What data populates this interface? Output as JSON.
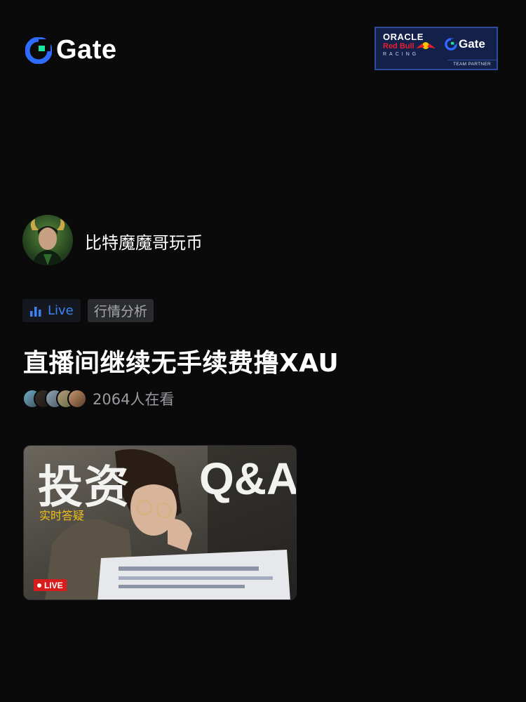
{
  "header": {
    "logo_text": "Gate",
    "partner": {
      "brand_1": "ORACLE",
      "brand_2": "Red Bull",
      "brand_3": "RACING",
      "gate_text": "Gate",
      "badge": "TEAM PARTNER"
    }
  },
  "streamer": {
    "name": "比特魔魔哥玩币"
  },
  "tags": {
    "live": "Live",
    "category": "行情分析"
  },
  "stream": {
    "title": "直播间继续无手续费撸XAU",
    "viewers": "2064人在看"
  },
  "thumbnail": {
    "headline_left": "投资",
    "headline_right": "Q&A",
    "subheadline": "实时答疑",
    "live_badge": "LIVE"
  },
  "colors": {
    "background": "#0a0a0b",
    "accent_blue": "#3c82f6",
    "live_red": "#d81b1b",
    "gate_green": "#17e5a0"
  }
}
